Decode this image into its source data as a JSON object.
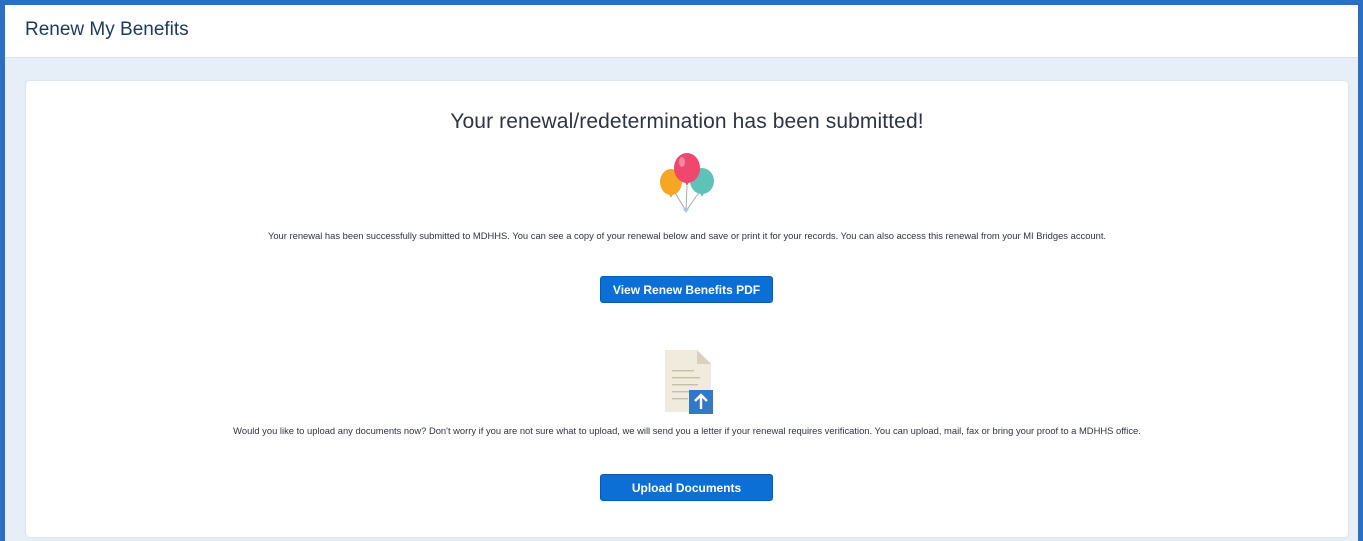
{
  "header": {
    "title": "Renew My Benefits"
  },
  "confirmation": {
    "headline": "Your renewal/redetermination has been submitted!",
    "submitted_message": "Your renewal has been successfully submitted to MDHHS. You can see a copy of your renewal below and save or print it for your records. You can also access this renewal from your MI Bridges account.",
    "view_pdf_label": "View Renew Benefits PDF",
    "upload_message": "Would you like to upload any documents now? Don't worry if you are not sure what to upload, we will send you a letter if your renewal requires verification. You can upload, mail, fax or bring your proof to a MDHHS office.",
    "upload_label": "Upload Documents"
  },
  "icons": {
    "celebration": "balloons-icon",
    "upload": "document-upload-icon"
  },
  "colors": {
    "frame_border": "#2b6fc4",
    "page_background": "#e6eff8",
    "button": "#0b6fd6",
    "balloon_pink": "#f0476f",
    "balloon_orange": "#f6a623",
    "balloon_teal": "#5fc2b7"
  }
}
